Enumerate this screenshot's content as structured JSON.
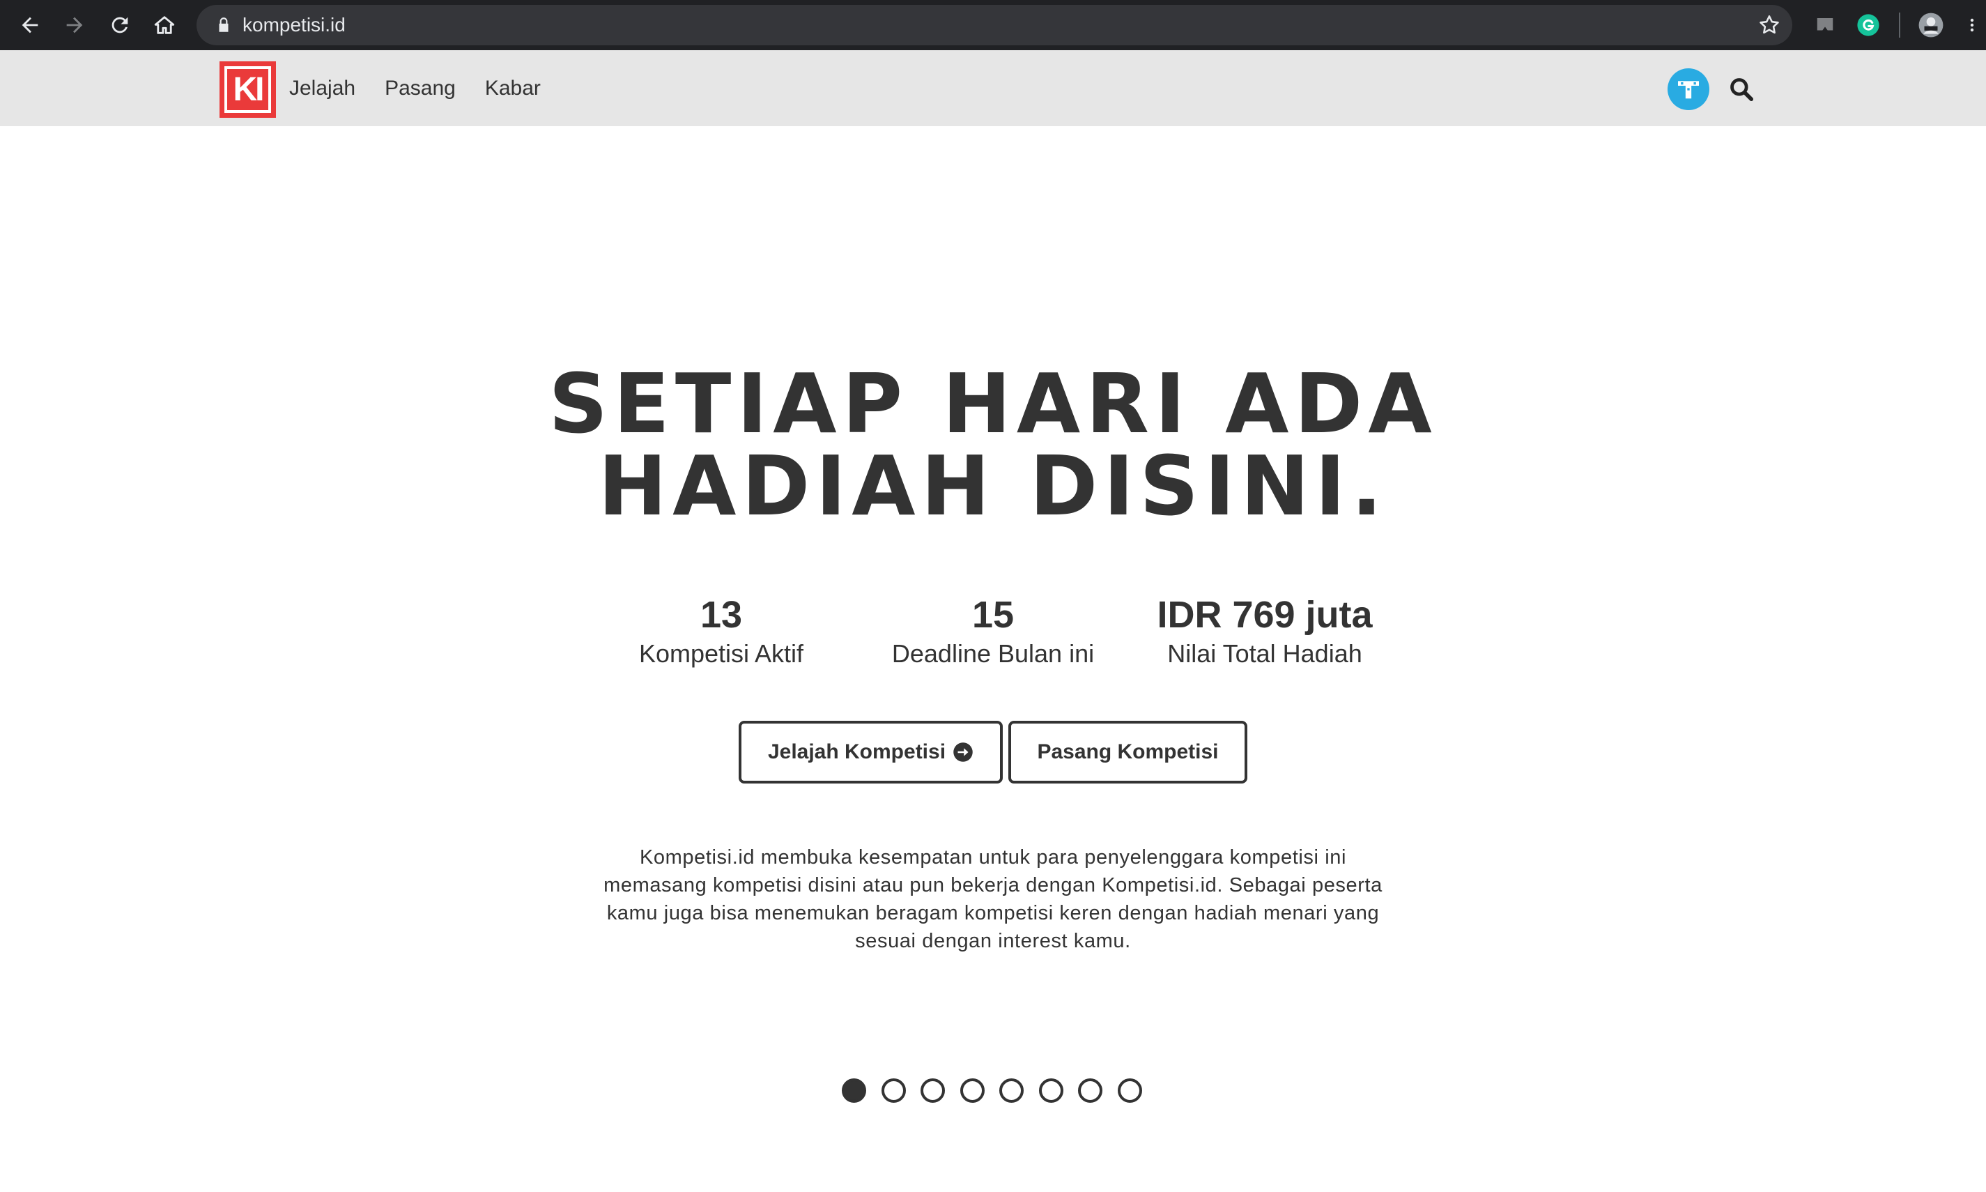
{
  "browser": {
    "url": "kompetisi.id",
    "icons": [
      "back-arrow-icon",
      "forward-arrow-icon",
      "reload-icon",
      "home-icon",
      "lock-icon",
      "star-icon",
      "cast-icon",
      "grammarly-icon",
      "profile-icon",
      "menu-icon"
    ]
  },
  "header": {
    "logo_text": "KI",
    "nav": [
      "Jelajah",
      "Pasang",
      "Kabar"
    ],
    "accent_color": "#ea3a3a",
    "avatar_color": "#29abe2"
  },
  "hero": {
    "title_line1": "SETIAP HARI ADA",
    "title_line2": "HADIAH DISINI.",
    "stats": [
      {
        "value": "13",
        "label": "Kompetisi Aktif"
      },
      {
        "value": "15",
        "label": "Deadline Bulan ini"
      },
      {
        "value": "IDR 769 juta",
        "label": "Nilai Total Hadiah"
      }
    ],
    "buttons": {
      "explore": "Jelajah Kompetisi",
      "post": "Pasang Kompetisi"
    },
    "description_lines": [
      "Kompetisi.id membuka kesempatan untuk para penyelenggara kompetisi ini",
      "memasang kompetisi disini atau pun bekerja dengan Kompetisi.id. Sebagai peserta",
      "kamu juga bisa menemukan beragam kompetisi keren dengan hadiah menari yang",
      "sesuai dengan interest kamu."
    ]
  },
  "carousel": {
    "total": 8,
    "active": 1
  }
}
